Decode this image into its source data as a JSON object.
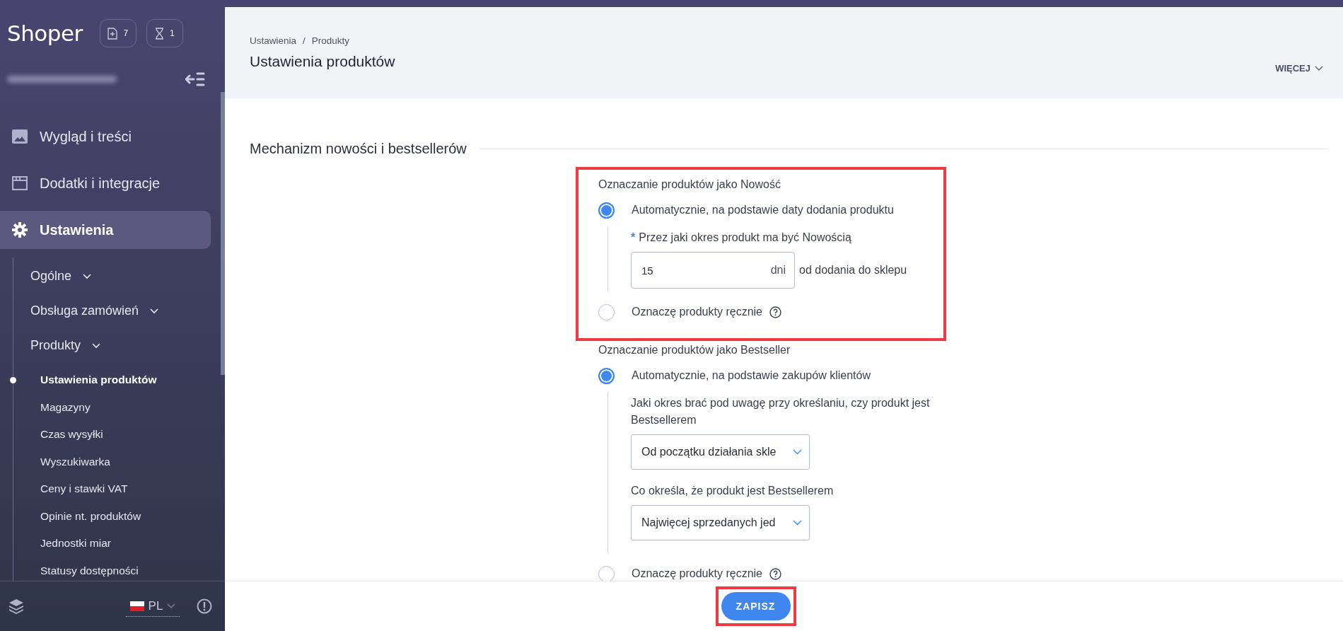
{
  "sidebar": {
    "logo": "Shoper",
    "badges": [
      {
        "kind": "new-doc",
        "count": "7"
      },
      {
        "kind": "hourglass",
        "count": "1"
      }
    ],
    "nav": [
      {
        "label": "Wygląd i treści",
        "selected": false
      },
      {
        "label": "Dodatki i integracje",
        "selected": false
      },
      {
        "label": "Ustawienia",
        "selected": true,
        "children": [
          {
            "label": "Ogólne"
          },
          {
            "label": "Obsługa zamówień"
          },
          {
            "label": "Produkty",
            "children": [
              {
                "label": "Ustawienia produktów",
                "selected": true
              },
              {
                "label": "Magazyny",
                "selected": false
              },
              {
                "label": "Czas wysyłki",
                "selected": false
              },
              {
                "label": "Wyszukiwarka",
                "selected": false
              },
              {
                "label": "Ceny i stawki VAT",
                "selected": false
              },
              {
                "label": "Opinie nt. produktów",
                "selected": false
              },
              {
                "label": "Jednostki miar",
                "selected": false
              },
              {
                "label": "Statusy dostępności",
                "selected": false
              }
            ]
          }
        ]
      }
    ],
    "language": "PL"
  },
  "header": {
    "breadcrumbs": [
      "Ustawienia",
      "Produkty"
    ],
    "separator": "/",
    "title": "Ustawienia produktów",
    "more": "WIĘCEJ"
  },
  "section": {
    "title": "Mechanizm nowości i bestsellerów",
    "groups": [
      {
        "label": "Oznaczanie produktów jako Nowość",
        "highlighted": true,
        "options": [
          {
            "label": "Automatycznie, na podstawie daty dodania produktu",
            "selected": true,
            "help": false,
            "fields": [
              {
                "kind": "number",
                "label": "Przez jaki okres produkt ma być Nowością",
                "required_mark": "*",
                "value": "15",
                "unit": "dni",
                "suffix": "od dodania do sklepu"
              }
            ]
          },
          {
            "label": "Oznaczę produkty ręcznie",
            "selected": false,
            "help": true
          }
        ]
      },
      {
        "label": "Oznaczanie produktów jako Bestseller",
        "highlighted": false,
        "options": [
          {
            "label": "Automatycznie, na podstawie zakupów klientów",
            "selected": true,
            "help": false,
            "fields": [
              {
                "kind": "select",
                "label": "Jaki okres brać pod uwagę przy określaniu, czy produkt jest Bestsellerem",
                "value": "Od początku działania skle"
              },
              {
                "kind": "select",
                "label": "Co określa, że produkt jest Bestsellerem",
                "value": "Najwięcej sprzedanych jed"
              }
            ]
          },
          {
            "label": "Oznaczę produkty ręcznie",
            "selected": false,
            "help": true
          }
        ]
      }
    ]
  },
  "footer": {
    "save": "ZAPISZ",
    "highlighted": true
  }
}
